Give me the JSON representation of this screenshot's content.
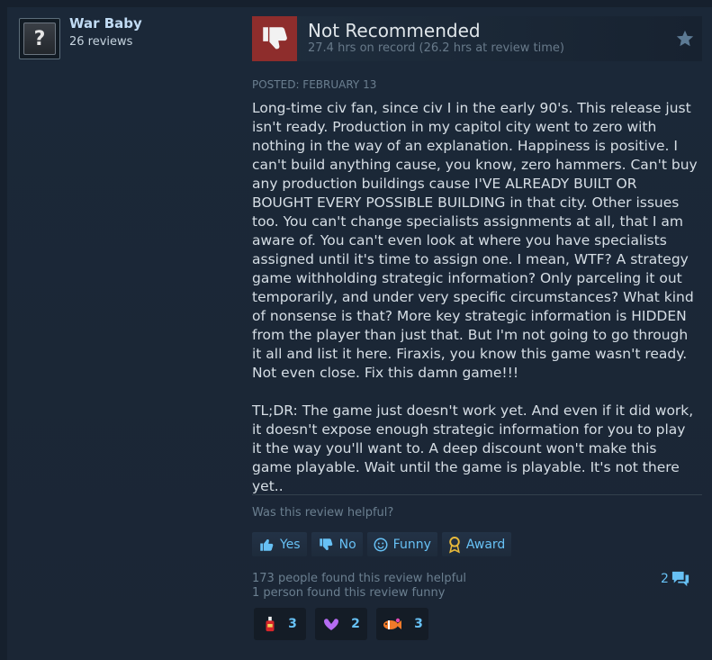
{
  "author": {
    "name": "War Baby",
    "reviews": "26 reviews",
    "avatar_glyph": "?"
  },
  "header": {
    "title": "Not Recommended",
    "hours": "27.4 hrs on record (26.2 hrs at review time)",
    "thumb_color": "#8e2d2c"
  },
  "posted": "POSTED: FEBRUARY 13",
  "review_body": "Long-time civ fan, since civ I in the early 90's. This release just isn't ready. Production in my capitol city went to zero with nothing in the way of an explanation. Happiness is positive. I can't build anything cause, you know, zero hammers. Can't buy any production buildings cause I'VE ALREADY BUILT OR BOUGHT EVERY POSSIBLE BUILDING in that city. Other issues too. You can't change specialists assignments at all, that I am aware of. You can't even look at where you have specialists assigned until it's time to assign one. I mean, WTF? A strategy game withholding strategic information? Only parceling it out temporarily, and under very specific circumstances? What kind of nonsense is that? More key strategic information is HIDDEN from the player than just that. But I'm not going to go through it all and list it here. Firaxis, you know this game wasn't ready. Not even close. Fix this damn game!!!\n\nTL;DR: The game just doesn't work yet. And even if it did work, it doesn't expose enough strategic information for you to play it the way you'll want to. A deep discount won't make this game playable. Wait until the game is playable. It's not there yet..",
  "helpful_prompt": "Was this review helpful?",
  "buttons": {
    "yes": "Yes",
    "no": "No",
    "funny": "Funny",
    "award": "Award"
  },
  "stats": {
    "helpful": "173 people found this review helpful",
    "funny": "1 person found this review funny"
  },
  "comments_count": "2",
  "awards": [
    {
      "icon": "hot-sauce-icon",
      "count": "3"
    },
    {
      "icon": "heart-hands-icon",
      "count": "2"
    },
    {
      "icon": "clown-fish-icon",
      "count": "3"
    }
  ],
  "colors": {
    "link": "#67c1f5",
    "background": "#1b2838"
  }
}
